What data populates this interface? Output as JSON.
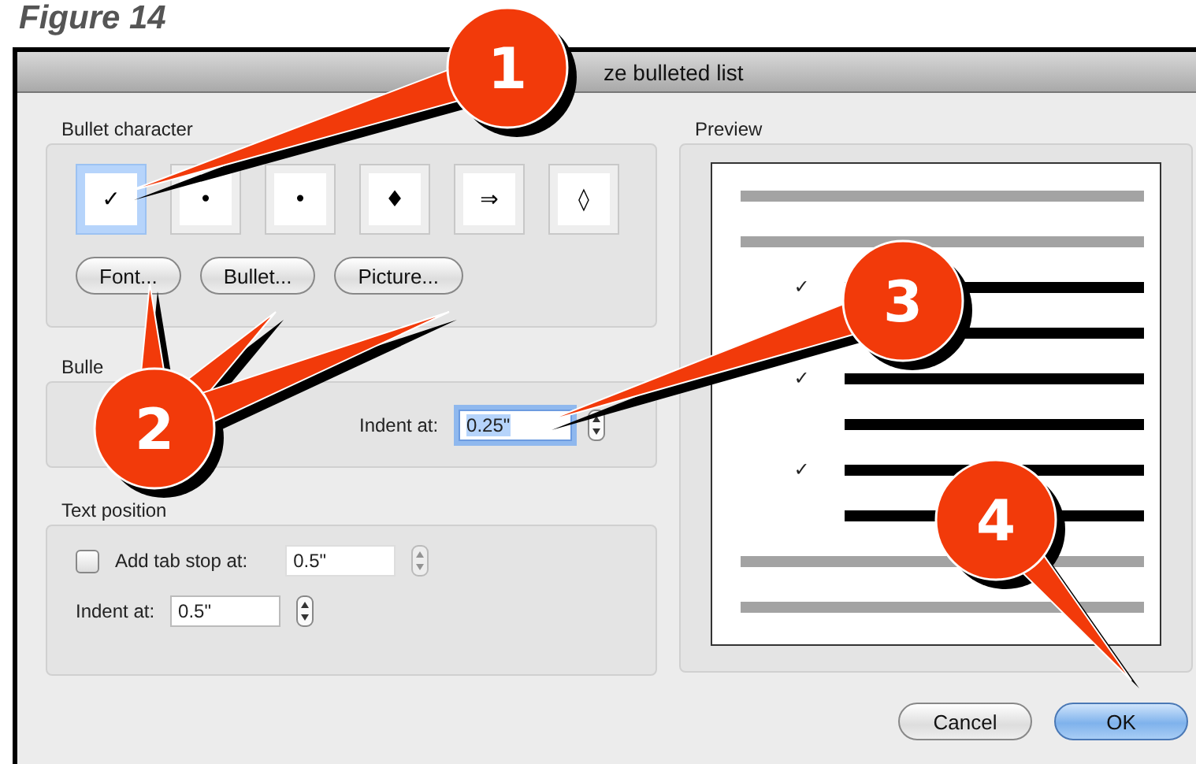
{
  "figure_caption": "Figure 14",
  "window": {
    "title": "ze bulleted list"
  },
  "bullet_character": {
    "label": "Bullet character",
    "bullets": [
      {
        "symbol": "✓",
        "selected": true
      },
      {
        "symbol": "•",
        "selected": false
      },
      {
        "symbol": "•",
        "selected": false
      },
      {
        "symbol": "♦",
        "selected": false
      },
      {
        "symbol": "⇒",
        "selected": false
      },
      {
        "symbol": "◊",
        "selected": false
      }
    ],
    "buttons": [
      "Font...",
      "Bullet...",
      "Picture..."
    ]
  },
  "bullet_position": {
    "label": "Bulle",
    "indent_label": "Indent at:",
    "indent_value": "0.25\"",
    "focused": true
  },
  "text_position": {
    "label": "Text position",
    "tab_stop": {
      "label": "Add tab stop at:",
      "checked": false,
      "value": "0.5\""
    },
    "indent": {
      "label": "Indent at:",
      "value": "0.5\""
    }
  },
  "preview": {
    "label": "Preview",
    "lines": [
      {
        "kind": "text"
      },
      {
        "kind": "text"
      },
      {
        "kind": "bullet",
        "bullet": "✓"
      },
      {
        "kind": "continuation"
      },
      {
        "kind": "bullet",
        "bullet": "✓"
      },
      {
        "kind": "continuation"
      },
      {
        "kind": "bullet",
        "bullet": "✓"
      },
      {
        "kind": "continuation"
      },
      {
        "kind": "text"
      },
      {
        "kind": "text"
      }
    ]
  },
  "buttons": [
    {
      "label": "Cancel",
      "default": false
    },
    {
      "label": "OK",
      "default": true
    }
  ],
  "callouts": [
    "1",
    "2",
    "3",
    "4"
  ]
}
